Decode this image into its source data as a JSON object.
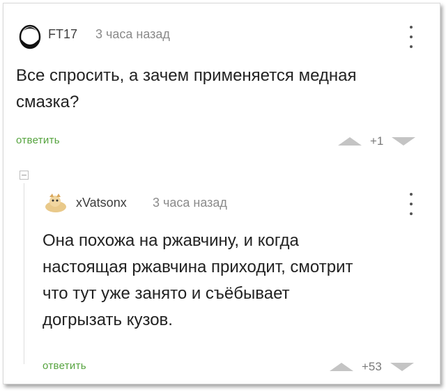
{
  "comments": [
    {
      "author": "FT17",
      "time": "3 часа назад",
      "text_lines": [
        "Все спросить, а зачем применяется медная",
        "смазка?"
      ],
      "reply_label": "ответить",
      "score": "+1"
    },
    {
      "author": "xVatsonx",
      "time": "3 часа назад",
      "text_lines": [
        "Она похожа на ржавчину, и когда",
        "настоящая ржавчина приходит, смотрит",
        "что тут уже занято и съёбывает",
        "догрызать кузов."
      ],
      "reply_label": "ответить",
      "score": "+53"
    }
  ],
  "colors": {
    "reply_link": "#55a33e",
    "vote_arrow": "#c4c4c4"
  },
  "icons": {
    "menu": "vertical-dots-icon",
    "upvote": "up-arrow-icon",
    "downvote": "down-arrow-icon",
    "collapse": "minus-square-icon"
  }
}
